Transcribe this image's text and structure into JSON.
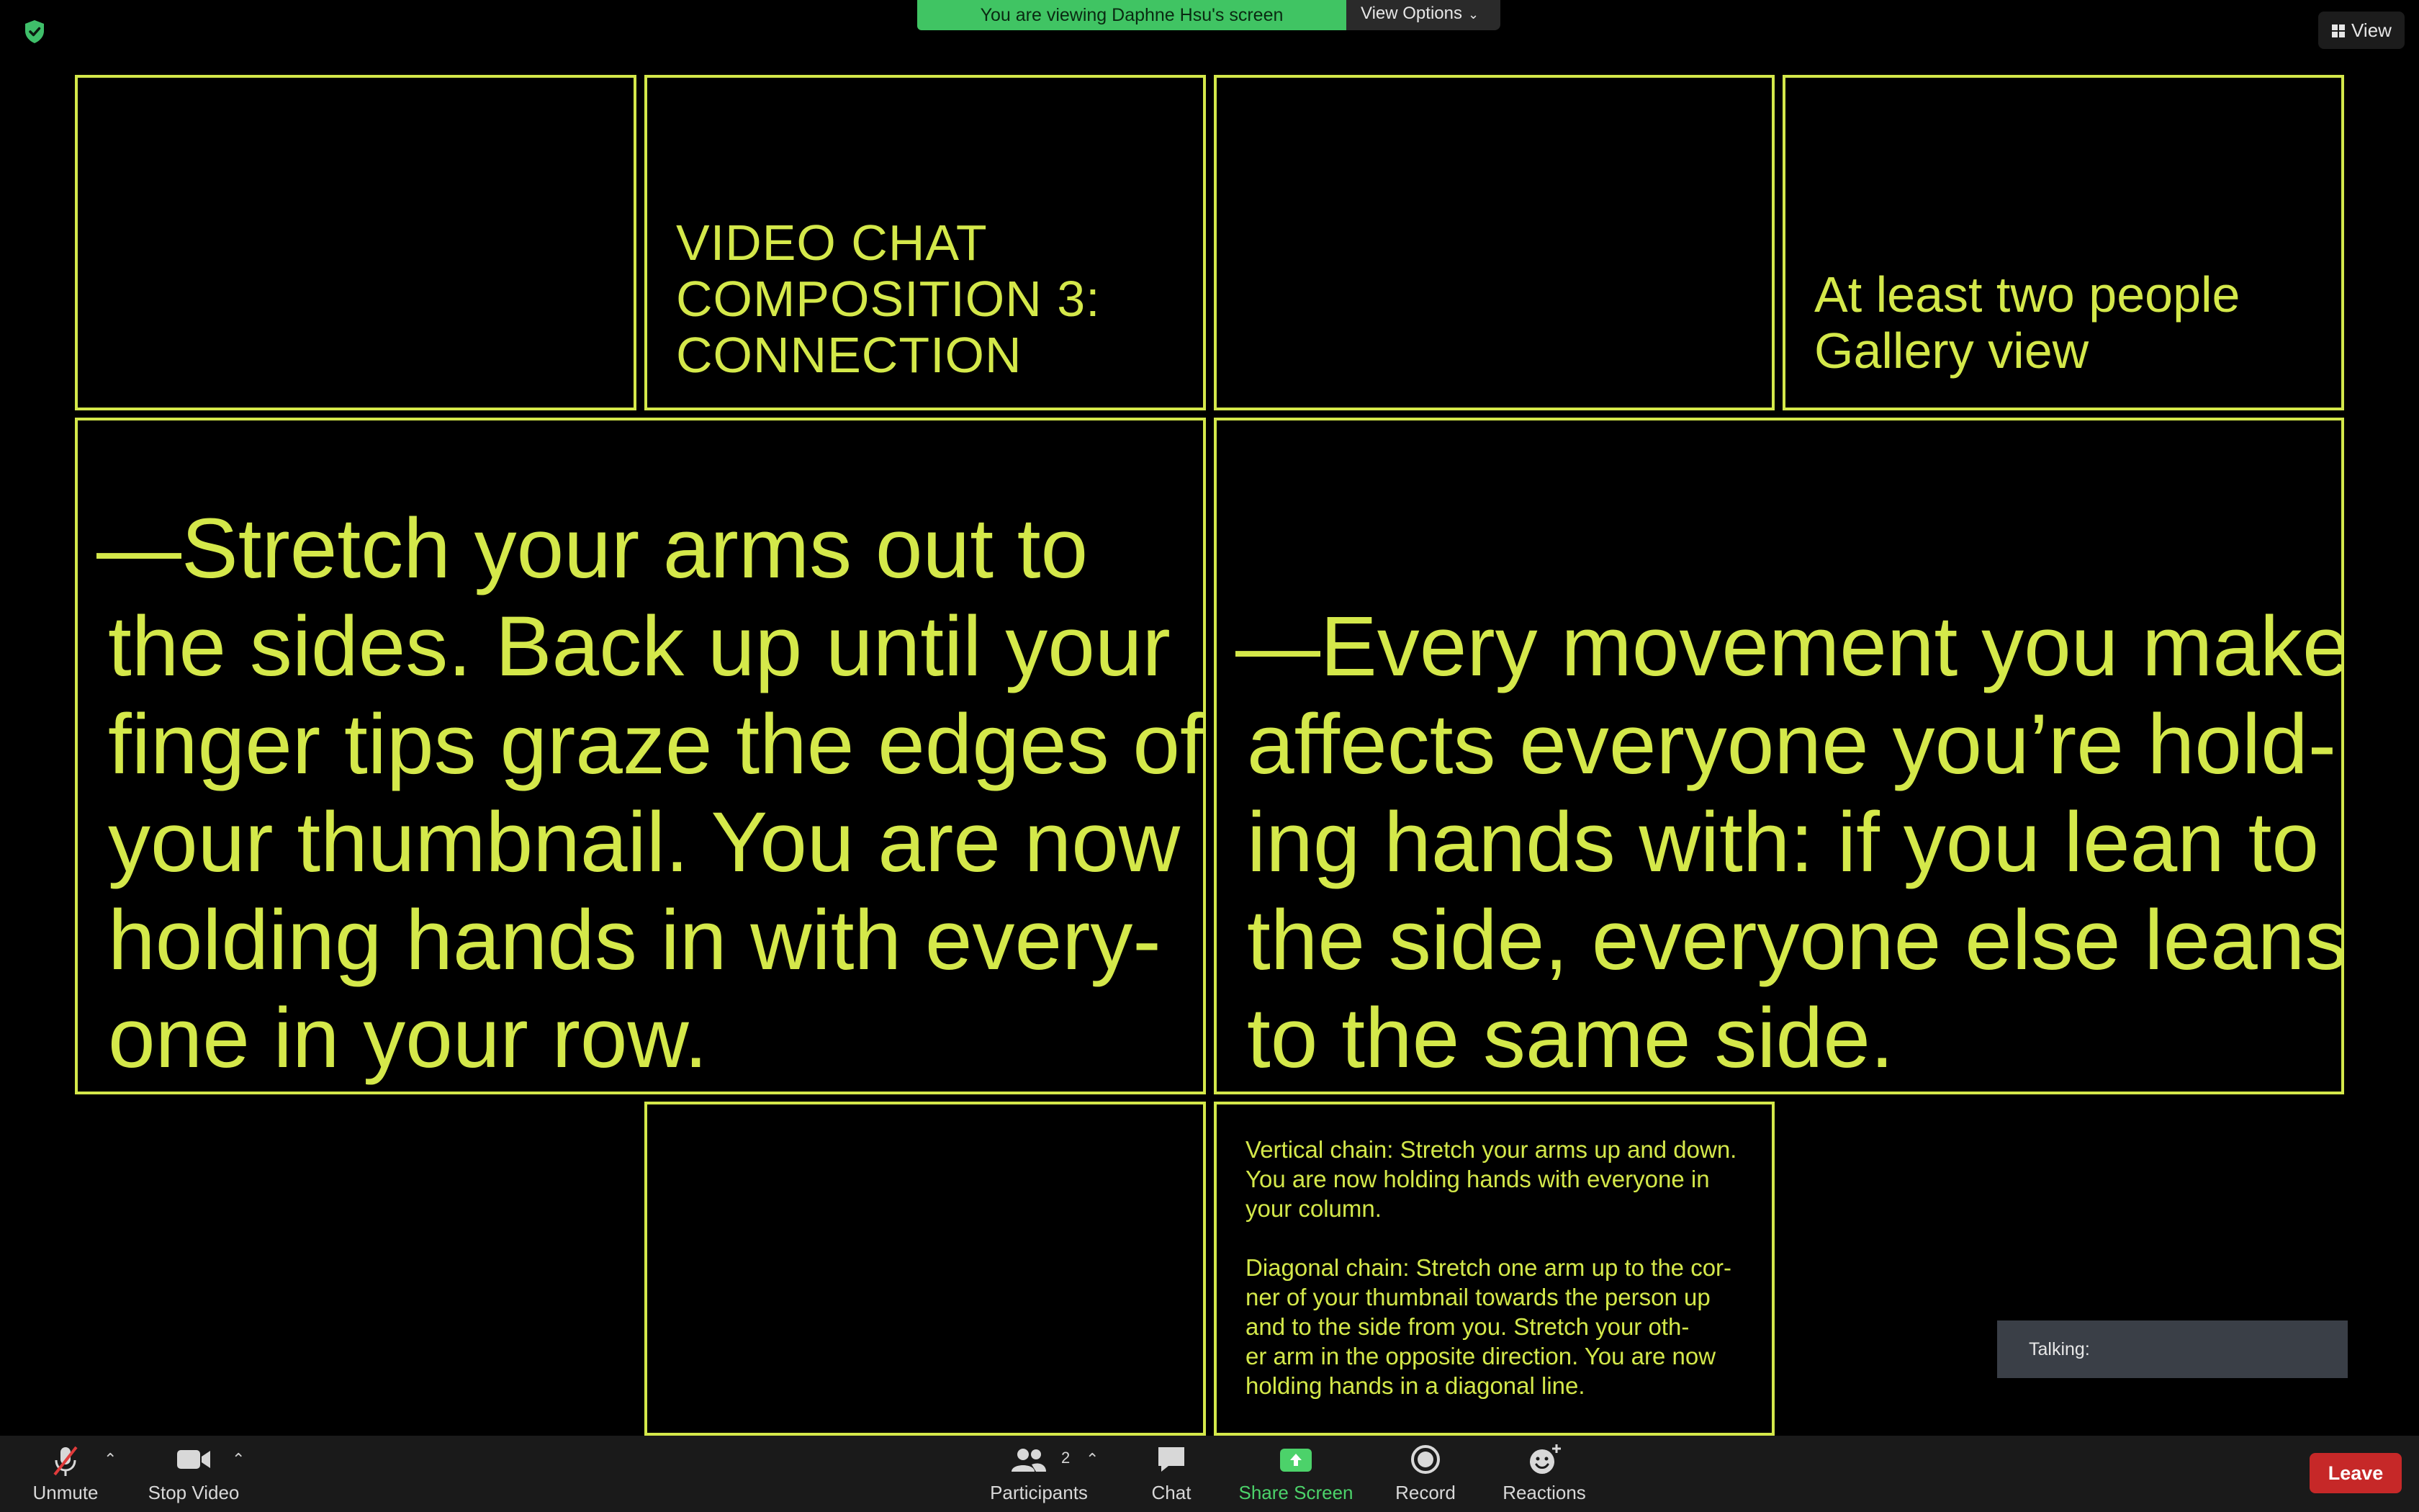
{
  "top_bar": {
    "banner_text": "You are viewing Daphne Hsu's screen",
    "view_options_label": "View Options",
    "view_button_label": "View",
    "banner_color": "#40c463"
  },
  "tiles": {
    "title_lines": [
      "VIDEO CHAT",
      "COMPOSITION 3:",
      "CONNECTION"
    ],
    "people_lines": [
      "At least two people",
      "Gallery view"
    ],
    "big_left_lines": [
      "—Stretch your arms out to",
      "the sides. Back up until your",
      "finger tips graze the edges of",
      "your thumbnail. You are now",
      "holding hands in with every-",
      "one in your row."
    ],
    "big_right_lines": [
      "—Every movement you make",
      "affects everyone you’re hold-",
      "ing hands with: if you lean to",
      "the side, everyone else leans",
      "to the same side."
    ],
    "small_para1": [
      "Vertical chain: Stretch your arms up and down.",
      "You are now holding hands with everyone in",
      "your column."
    ],
    "small_para2": [
      "Diagonal chain: Stretch one arm up to the cor-",
      "ner of your thumbnail towards the person up",
      "and to the side from you. Stretch your oth-",
      "er arm in the opposite direction. You are now",
      "holding hands in a diagonal line."
    ],
    "accent_color": "#d4e84a"
  },
  "talking_label": "Talking:",
  "toolbar": {
    "unmute": "Unmute",
    "stop_video": "Stop Video",
    "participants": "Participants",
    "participants_count": "2",
    "chat": "Chat",
    "share_screen": "Share Screen",
    "record": "Record",
    "reactions": "Reactions",
    "leave": "Leave",
    "share_color": "#4cd26a",
    "leave_color": "#c62828"
  }
}
